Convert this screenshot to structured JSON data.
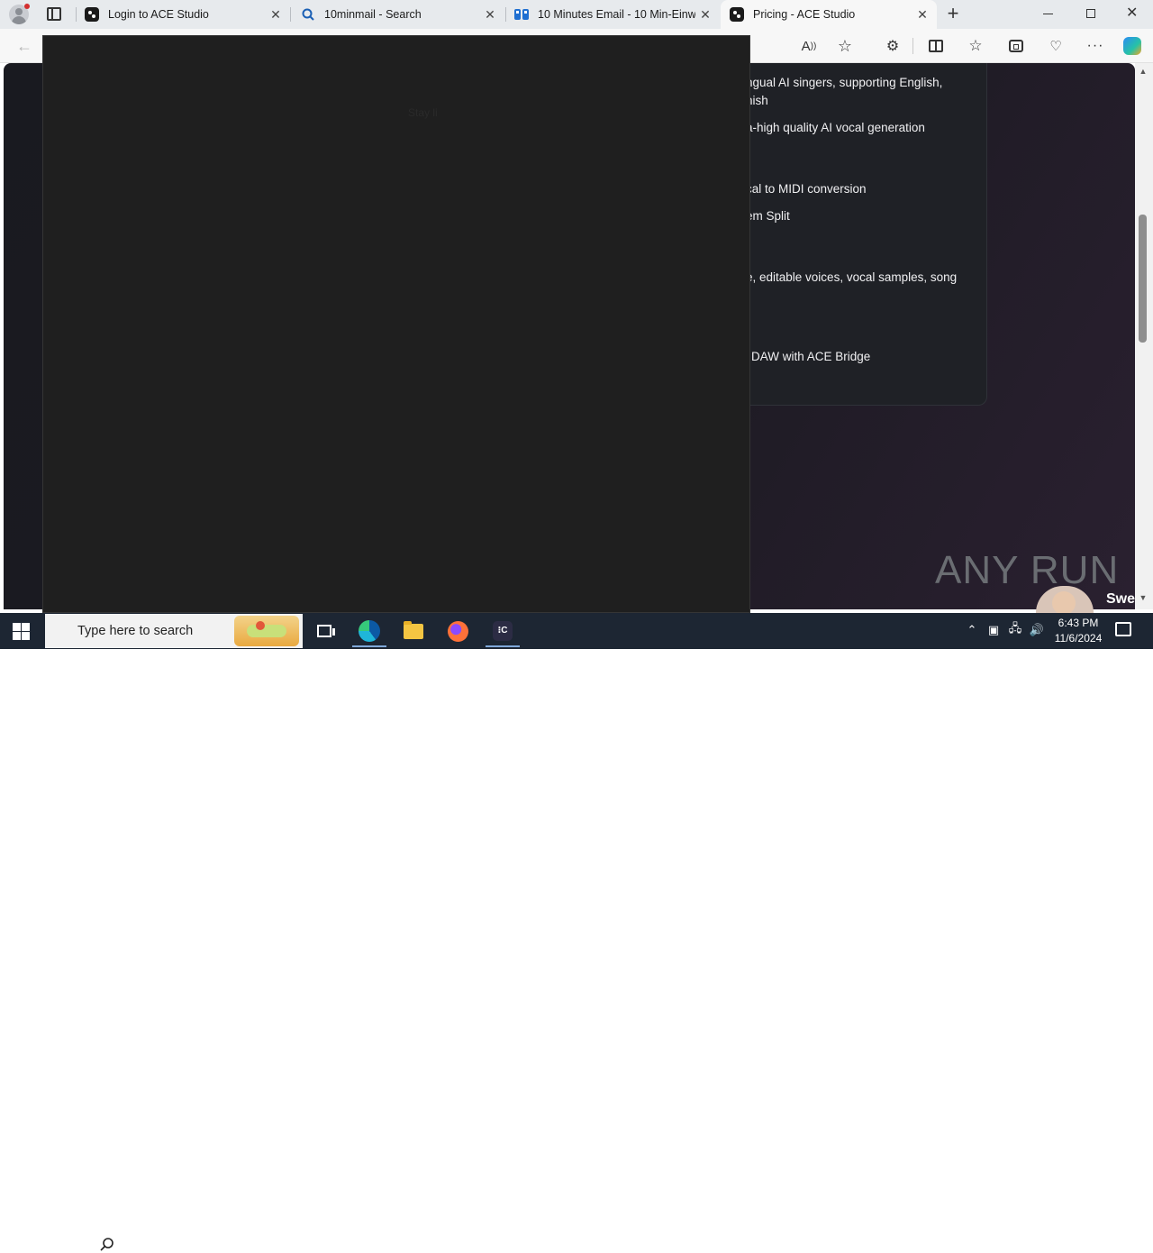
{
  "browser": {
    "tabs": [
      {
        "title": "Login to ACE Studio",
        "favicon": "ace-studio-icon"
      },
      {
        "title": "10minmail - Search",
        "favicon": "search-icon"
      },
      {
        "title": "10 Minutes Email - 10 Min-Einwe",
        "favicon": "tenminmail-icon"
      },
      {
        "title": "Pricing - ACE Studio",
        "favicon": "ace-studio-icon",
        "active": true
      }
    ],
    "new_tab_label": "+",
    "window_controls": [
      "minimize",
      "restore",
      "close"
    ]
  },
  "page": {
    "features": [
      "ngual AI singers, supporting English,",
      "nish",
      "a-high quality AI vocal generation",
      "cal to MIDI conversion",
      "em Split",
      "e, editable voices, vocal samples, song",
      "DAW with ACE Bridge"
    ],
    "watermark": "ANY RUN",
    "corner_text": "Swe"
  },
  "overlay": {
    "faint_label": "Stay li"
  },
  "taskbar": {
    "search_placeholder": "Type here to search",
    "time": "6:43 PM",
    "date": "11/6/2024"
  },
  "colors": {
    "taskbar": "#1d2633",
    "overlay": "#1f1f1f",
    "page_bg": "#191a20",
    "edge_accent": "#0c59a4"
  }
}
